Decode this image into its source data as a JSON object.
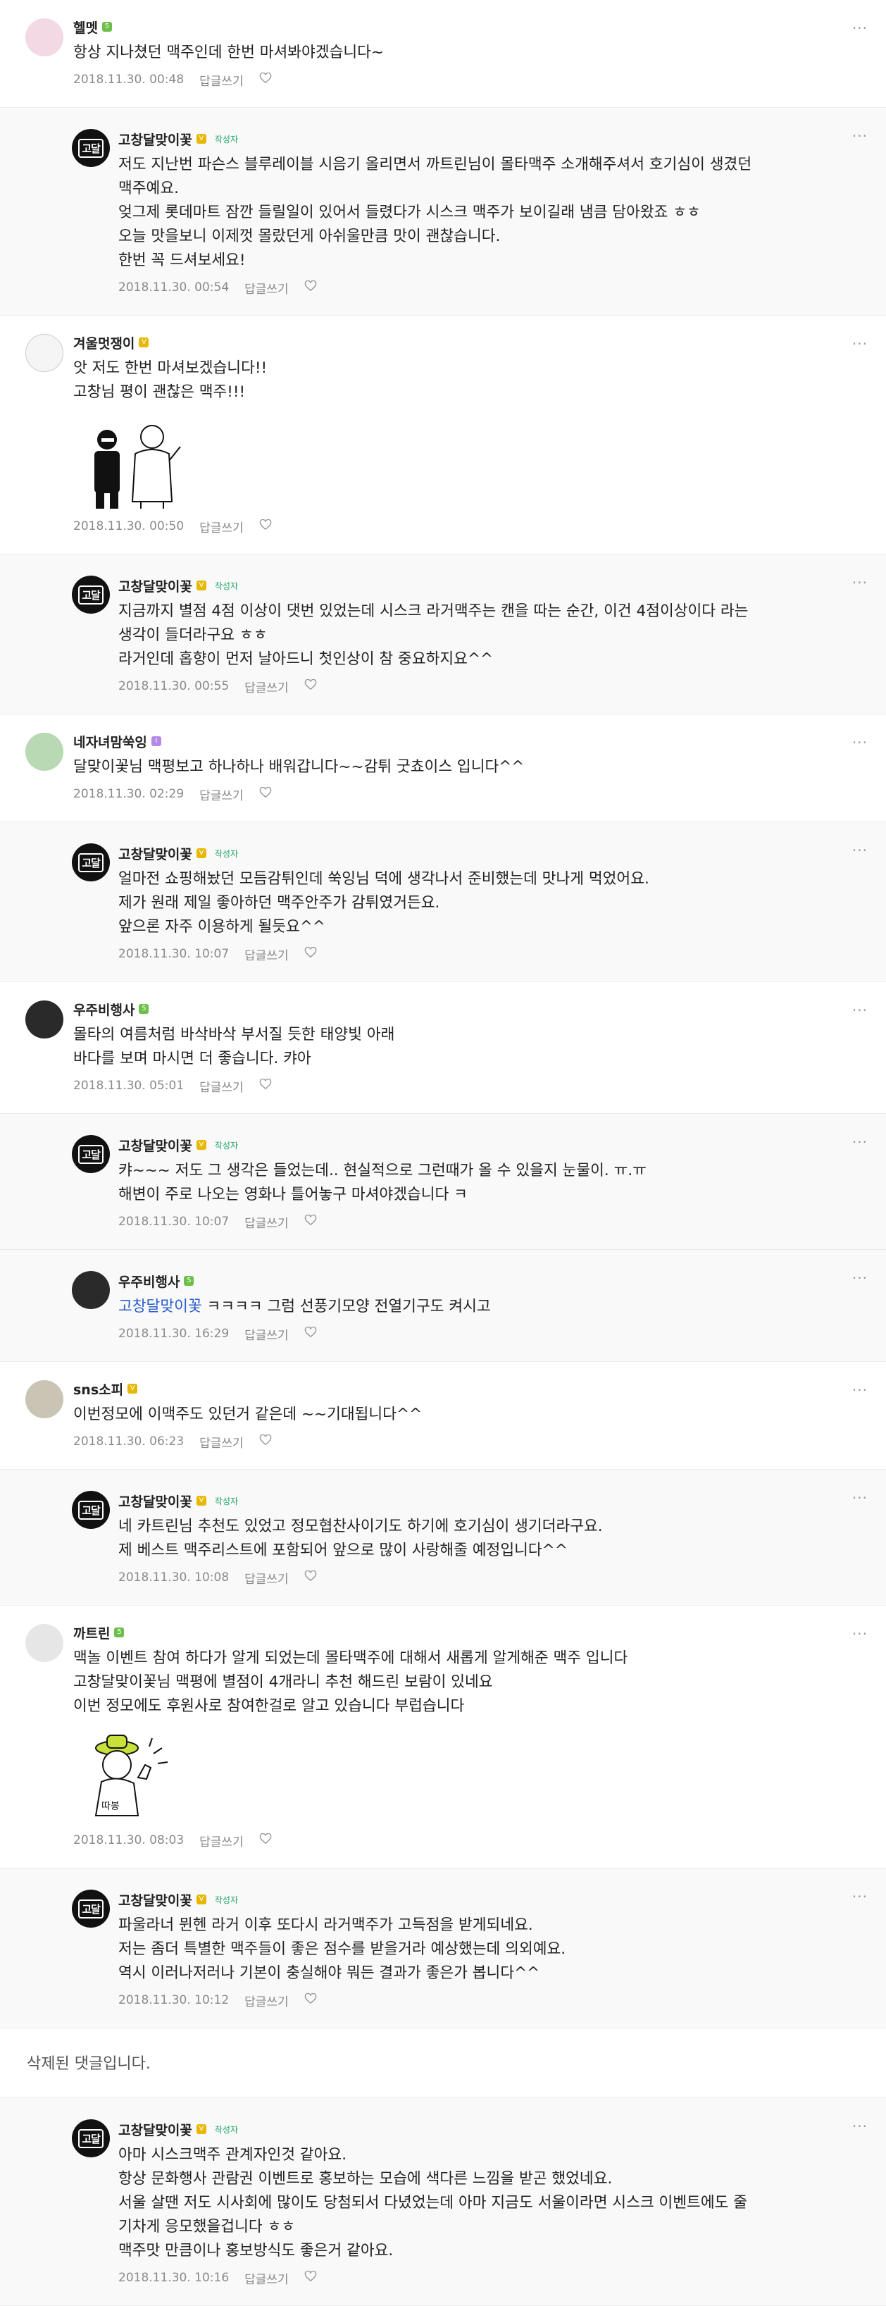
{
  "labels": {
    "reply": "답글쓰기",
    "author_tag": "작성자",
    "more": "···"
  },
  "comments": [
    {
      "type": "top",
      "avatar": "face",
      "nick": "헬멧",
      "badge": "green",
      "lines": [
        "항상 지나쳤던 맥주인데 한번 마셔봐야겠습니다~"
      ],
      "date": "2018.11.30. 00:48"
    },
    {
      "type": "reply",
      "avatar": "logo",
      "nick": "고창달맞이꽃",
      "badge": "v",
      "author": true,
      "lines": [
        "저도 지난번 파슨스 블루레이블 시음기 올리면서 까트린님이 몰타맥주 소개해주셔서 호기심이 생겼던",
        "맥주예요.",
        "엊그제 롯데마트 잠깐 들릴일이 있어서 들렸다가 시스크 맥주가 보이길래 냄큼 담아왔죠 ㅎㅎ",
        "오늘 맛을보니 이제껏 몰랐던게 아쉬울만큼 맛이 괜찮습니다.",
        "한번 꼭 드셔보세요!"
      ],
      "date": "2018.11.30. 00:54"
    },
    {
      "type": "top",
      "avatar": "clown",
      "nick": "겨울멋쟁이",
      "badge": "v",
      "lines": [
        "앗 저도 한번 마셔보겠습니다!!",
        "고창님 평이 괜찮은 맥주!!!"
      ],
      "sticker": "men",
      "date": "2018.11.30. 00:50"
    },
    {
      "type": "reply",
      "avatar": "logo",
      "nick": "고창달맞이꽃",
      "badge": "v",
      "author": true,
      "lines": [
        "지금까지 별점 4점 이상이 댓번 있었는데 시스크 라거맥주는 캔을 따는 순간, 이건 4점이상이다 라는",
        "생각이 들더라구요 ㅎㅎ",
        "라거인데 홉향이 먼저 날아드니 첫인상이 참 중요하지요^^"
      ],
      "date": "2018.11.30. 00:55"
    },
    {
      "type": "top",
      "avatar": "robot",
      "nick": "네자녀맘쑥잉",
      "badge": "p",
      "lines": [
        "달맞이꽃님 맥평보고 하나하나 배워갑니다~~감튀 굿쵸이스 입니다^^"
      ],
      "date": "2018.11.30. 02:29"
    },
    {
      "type": "reply",
      "avatar": "logo",
      "nick": "고창달맞이꽃",
      "badge": "v",
      "author": true,
      "lines": [
        "얼마전 쇼핑해놨던 모듬감튀인데 쑥잉님 덕에 생각나서 준비했는데 맛나게 먹었어요.",
        "제가 원래 제일 좋아하던 맥주안주가 감튀였거든요.",
        "앞으론 자주 이용하게 될듯요^^"
      ],
      "date": "2018.11.30. 10:07"
    },
    {
      "type": "top",
      "avatar": "space",
      "nick": "우주비행사",
      "badge": "green",
      "lines": [
        "몰타의 여름처럼 바삭바삭 부서질 듯한 태양빛 아래",
        "바다를 보며 마시면 더 좋습니다. 캬아"
      ],
      "date": "2018.11.30. 05:01"
    },
    {
      "type": "reply",
      "avatar": "logo",
      "nick": "고창달맞이꽃",
      "badge": "v",
      "author": true,
      "lines": [
        "캬~~~ 저도 그 생각은 들었는데.. 현실적으로 그런때가 올 수 있을지 눈물이. ㅠ.ㅠ",
        "해변이 주로 나오는 영화나 틀어놓구 마셔야겠습니다 ㅋ"
      ],
      "date": "2018.11.30. 10:07"
    },
    {
      "type": "reply",
      "avatar": "space",
      "nick": "우주비행사",
      "badge": "green",
      "mention": "고창달맞이꽃",
      "lines": [
        " ㅋㅋㅋㅋ 그럼 선풍기모양 전열기구도 켜시고"
      ],
      "date": "2018.11.30. 16:29"
    },
    {
      "type": "top",
      "avatar": "tan",
      "nick": "sns소피",
      "badge": "v",
      "lines": [
        "이번정모에 이맥주도 있던거 같은데 ~~기대됩니다^^"
      ],
      "date": "2018.11.30. 06:23"
    },
    {
      "type": "reply",
      "avatar": "logo",
      "nick": "고창달맞이꽃",
      "badge": "v",
      "author": true,
      "lines": [
        "네 카트린님 추천도 있었고 정모협찬사이기도 하기에 호기심이 생기더라구요.",
        "제 베스트 맥주리스트에 포함되어 앞으로 많이 사랑해줄 예정입니다^^"
      ],
      "date": "2018.11.30. 10:08"
    },
    {
      "type": "top",
      "avatar": "blank",
      "nick": "까트린",
      "badge": "green",
      "lines": [
        "맥놀 이벤트 참여 하다가 알게 되었는데 몰타맥주에 대해서 새롭게 알게해준 맥주 입니다",
        "고창달맞이꽃님 맥평에 별점이 4개라니 추천 해드린 보람이 있네요",
        "이번 정모에도 후원사로 참여한걸로 알고 있습니다 부럽습니다"
      ],
      "sticker": "thumbs",
      "sticker_text": "따봉",
      "date": "2018.11.30. 08:03"
    },
    {
      "type": "reply",
      "avatar": "logo",
      "nick": "고창달맞이꽃",
      "badge": "v",
      "author": true,
      "lines": [
        "파울라너 뮌헨 라거 이후 또다시 라거맥주가 고득점을 받게되네요.",
        "저는 좀더 특별한 맥주들이 좋은 점수를 받을거라 예상했는데 의외예요.",
        "역시 이러나저러나 기본이 충실해야 뭐든 결과가 좋은가 봅니다^^"
      ],
      "date": "2018.11.30. 10:12"
    },
    {
      "type": "deleted",
      "text": "삭제된 댓글입니다."
    },
    {
      "type": "reply",
      "avatar": "logo",
      "nick": "고창달맞이꽃",
      "badge": "v",
      "author": true,
      "lines": [
        "아마 시스크맥주 관계자인것 같아요.",
        "항상 문화행사 관람권 이벤트로 홍보하는 모습에 색다른 느낌을 받곤 했었네요.",
        "서울 살땐 저도 시사회에 많이도 당첨되서 다녔었는데 아마 지금도 서울이라면 시스크 이벤트에도 줄",
        "기차게 응모했을겁니다 ㅎㅎ",
        "맥주맛 만큼이나 홍보방식도 좋은거 같아요."
      ],
      "date": "2018.11.30. 10:16"
    }
  ]
}
